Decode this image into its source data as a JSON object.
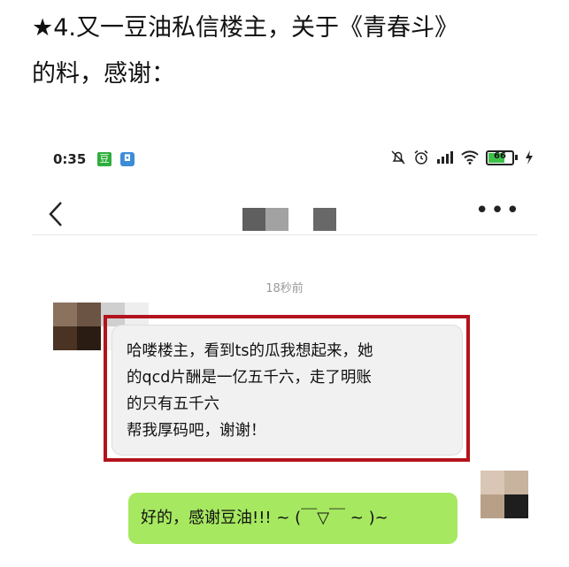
{
  "heading": {
    "line1": "★4.又一豆油私信楼主，关于《青春斗》",
    "line2": "的料，感谢："
  },
  "status_bar": {
    "time": "0:35",
    "app_icons": [
      "douban-icon",
      "message-app-icon"
    ],
    "indicators": [
      "mute-alarm-icon",
      "alarm-icon",
      "signal-icon",
      "wifi-icon"
    ],
    "battery_level": "66"
  },
  "nav": {
    "back_icon": "chevron-left-icon",
    "title_redacted": true,
    "more_icon": "more-icon"
  },
  "chat": {
    "timestamp": "18秒前",
    "incoming": {
      "lines": [
        "哈喽楼主，看到ts的瓜我想起来，她",
        "的qcd片酬是一亿五千六，走了明账",
        "的只有五千六",
        "帮我厚码吧，谢谢！"
      ]
    },
    "outgoing": {
      "text": "好的，感谢豆油!!! ~ (￣▽￣ ~ )~"
    }
  },
  "colors": {
    "highlight_border": "#b3131c",
    "incoming_bubble": "#f1f1f1",
    "outgoing_bubble": "#a6e860"
  }
}
